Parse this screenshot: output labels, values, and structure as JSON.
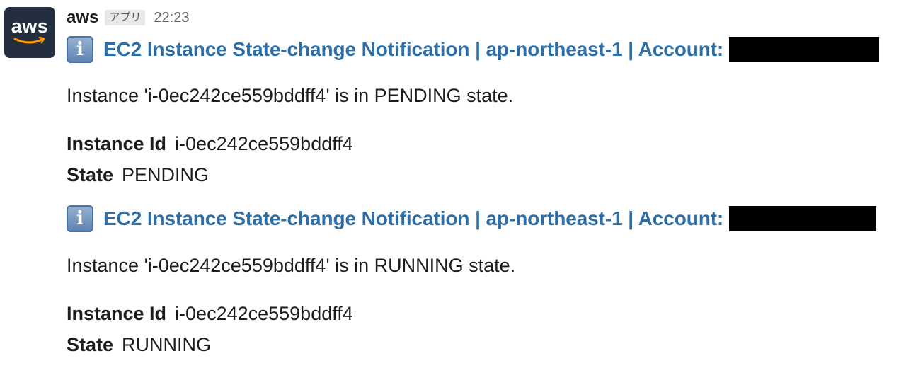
{
  "message": {
    "avatar": {
      "text": "aws",
      "bg_color": "#232f3e",
      "smile_color": "#ff9900"
    },
    "sender": "aws",
    "app_badge": "アプリ",
    "timestamp": "22:23"
  },
  "notifications": [
    {
      "icon": "info-icon",
      "title": "EC2 Instance State-change Notification | ap-northeast-1 | Account:",
      "account_redacted": true,
      "summary": "Instance 'i-0ec242ce559bddff4' is in PENDING state.",
      "fields": [
        {
          "label": "Instance Id",
          "value": "i-0ec242ce559bddff4"
        },
        {
          "label": "State",
          "value": "PENDING"
        }
      ]
    },
    {
      "icon": "info-icon",
      "title": "EC2 Instance State-change Notification | ap-northeast-1 | Account:",
      "account_redacted": true,
      "summary": "Instance 'i-0ec242ce559bddff4' is in RUNNING state.",
      "fields": [
        {
          "label": "Instance Id",
          "value": "i-0ec242ce559bddff4"
        },
        {
          "label": "State",
          "value": "RUNNING"
        }
      ]
    }
  ],
  "colors": {
    "link": "#2e6ea6",
    "text": "#1d1c1d",
    "muted": "#616061",
    "info_icon": "#5a82b1"
  }
}
